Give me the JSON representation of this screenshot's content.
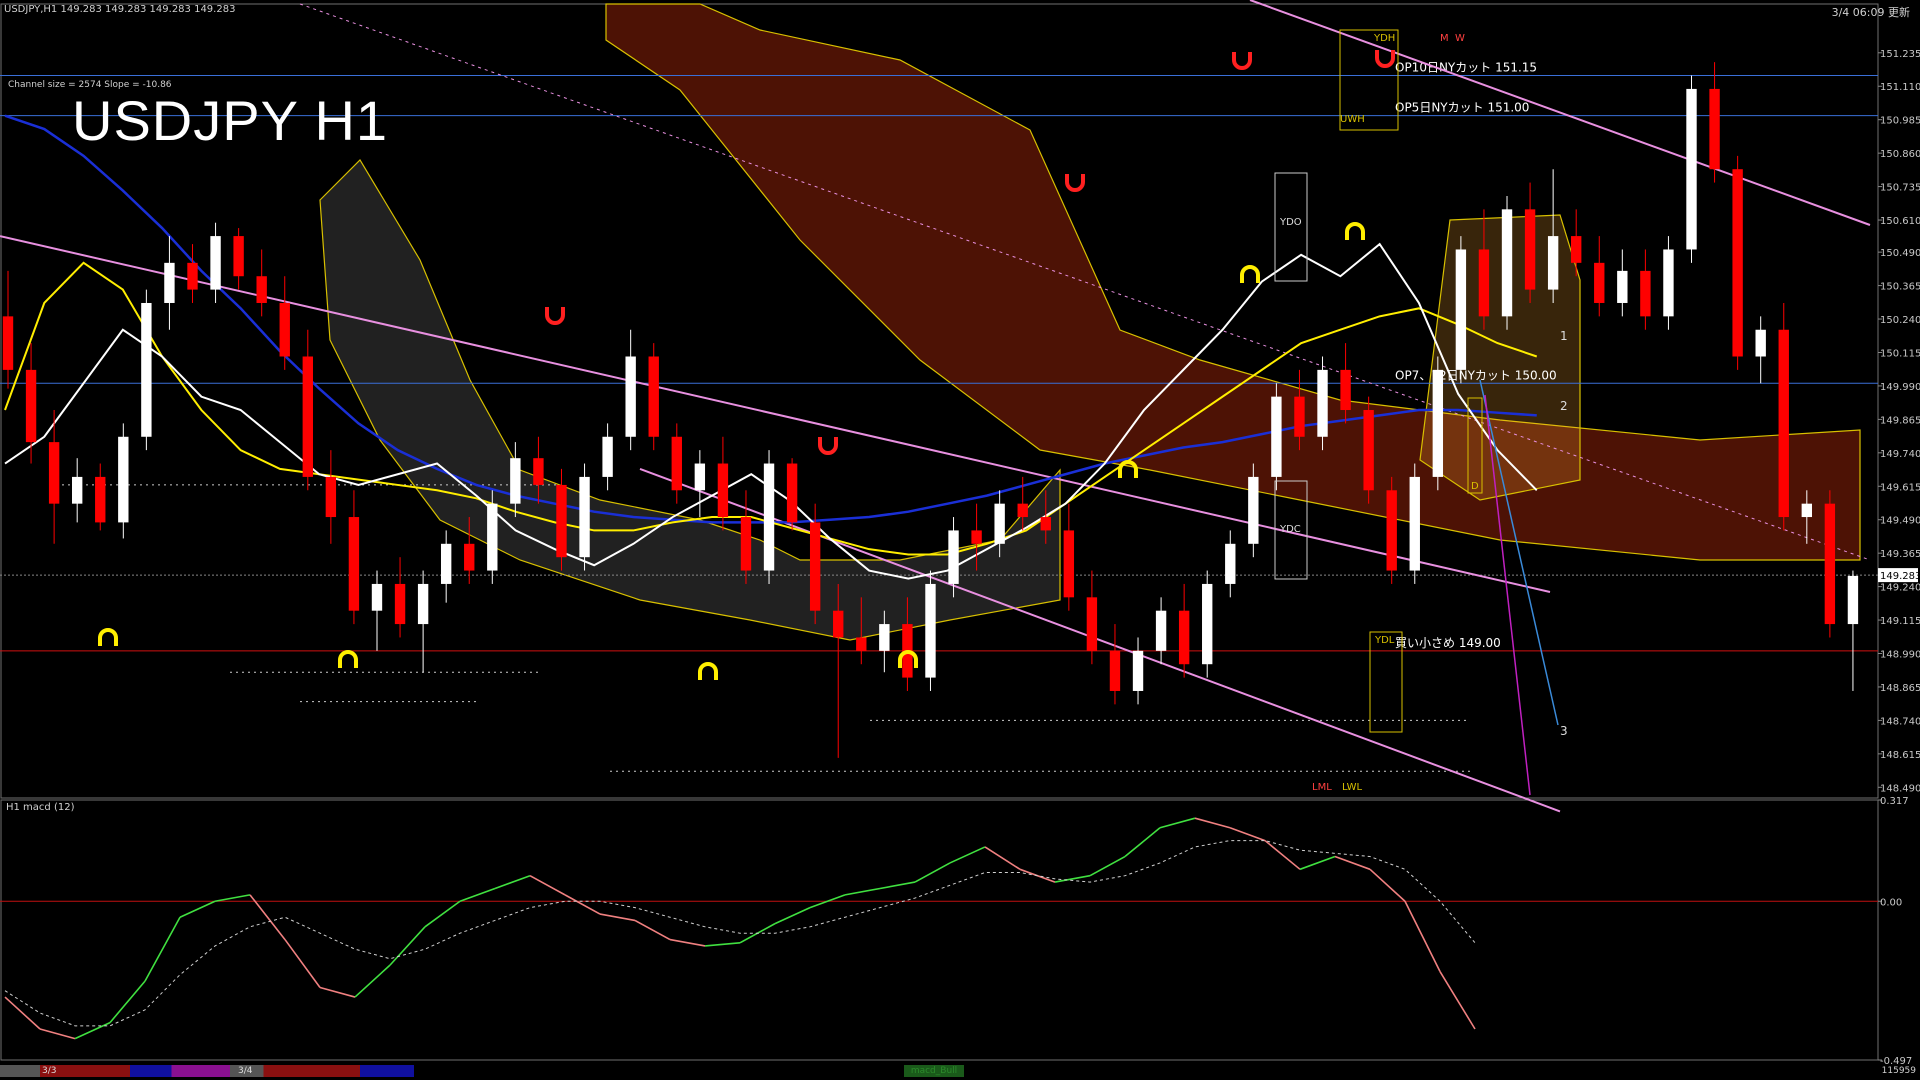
{
  "header": {
    "symbol_info": "USDJPY,H1",
    "ohlc": "149.283 149.283 149.283 149.283",
    "channel_info": "Channel size = 2574 Slope = -10.86",
    "timestamp": "3/4 06:09 更新"
  },
  "watermark": "USDJPY H1",
  "indicator_panel": {
    "label": "H1 macd (12)"
  },
  "colors": {
    "background": "#000000",
    "bull_candle": "#ffffff",
    "bear_candle": "#ff0000",
    "ma_white": "#ffffff",
    "ma_yellow": "#ffee00",
    "ma_blue": "#1a2fd6",
    "channel_pink": "#e890e0",
    "option_line_blue": "#3a6fd8",
    "support_red": "#d01010",
    "cloud_red": "#ff3a10",
    "cloud_white": "#e8e8e8",
    "cloud_orange": "#ffaa30",
    "cloud_edge_yellow": "#d8c000",
    "bollinger_red": "#c01010",
    "rsi_green": "#22c022",
    "macd_up": "#40e040",
    "macd_down": "#f08080",
    "signal_white": "#d0d0d0",
    "marker_yellow": "#ffee00",
    "marker_red": "#ff2020"
  },
  "chart_data": [
    {
      "type": "candlestick",
      "title": "USDJPY H1",
      "y_ticks": [
        "151.235",
        "151.110",
        "150.985",
        "150.860",
        "150.735",
        "150.610",
        "150.490",
        "150.365",
        "150.240",
        "150.115",
        "149.990",
        "149.865",
        "149.740",
        "149.615",
        "149.490",
        "149.365",
        "149.240",
        "149.115",
        "148.990",
        "148.865",
        "148.740",
        "148.615",
        "148.490"
      ],
      "current_price": "149.283",
      "ylim": [
        148.45,
        151.38
      ],
      "levels": [
        {
          "price": 151.15,
          "label": "OP10日NYカット 151.15",
          "color": "#3a6fd8"
        },
        {
          "price": 151.0,
          "label": "OP5日NYカット 151.00",
          "color": "#3a6fd8"
        },
        {
          "price": 150.0,
          "label": "OP7、12日NYカット 150.00",
          "color": "#3a6fd8"
        },
        {
          "price": 149.0,
          "label": "買い小さめ 149.00",
          "color": "#d01010"
        }
      ],
      "annotations": [
        "YDH",
        "UWH",
        "M",
        "W",
        "YDO",
        "YDC",
        "YDL",
        "D",
        "LML",
        "LWL",
        "1",
        "2",
        "3"
      ],
      "x_labels": [
        "3/3",
        "3/4"
      ],
      "bars": [
        {
          "o": 150.25,
          "h": 150.42,
          "l": 149.98,
          "c": 150.05
        },
        {
          "o": 150.05,
          "h": 150.15,
          "l": 149.7,
          "c": 149.78
        },
        {
          "o": 149.78,
          "h": 149.9,
          "l": 149.4,
          "c": 149.55
        },
        {
          "o": 149.55,
          "h": 149.72,
          "l": 149.48,
          "c": 149.65
        },
        {
          "o": 149.65,
          "h": 149.7,
          "l": 149.45,
          "c": 149.48
        },
        {
          "o": 149.48,
          "h": 149.85,
          "l": 149.42,
          "c": 149.8
        },
        {
          "o": 149.8,
          "h": 150.35,
          "l": 149.75,
          "c": 150.3
        },
        {
          "o": 150.3,
          "h": 150.55,
          "l": 150.2,
          "c": 150.45
        },
        {
          "o": 150.45,
          "h": 150.52,
          "l": 150.3,
          "c": 150.35
        },
        {
          "o": 150.35,
          "h": 150.6,
          "l": 150.3,
          "c": 150.55
        },
        {
          "o": 150.55,
          "h": 150.58,
          "l": 150.35,
          "c": 150.4
        },
        {
          "o": 150.4,
          "h": 150.5,
          "l": 150.25,
          "c": 150.3
        },
        {
          "o": 150.3,
          "h": 150.4,
          "l": 150.05,
          "c": 150.1
        },
        {
          "o": 150.1,
          "h": 150.2,
          "l": 149.6,
          "c": 149.65
        },
        {
          "o": 149.65,
          "h": 149.75,
          "l": 149.4,
          "c": 149.5
        },
        {
          "o": 149.5,
          "h": 149.6,
          "l": 149.1,
          "c": 149.15
        },
        {
          "o": 149.15,
          "h": 149.3,
          "l": 149.0,
          "c": 149.25
        },
        {
          "o": 149.25,
          "h": 149.35,
          "l": 149.05,
          "c": 149.1
        },
        {
          "o": 149.1,
          "h": 149.3,
          "l": 148.92,
          "c": 149.25
        },
        {
          "o": 149.25,
          "h": 149.45,
          "l": 149.18,
          "c": 149.4
        },
        {
          "o": 149.4,
          "h": 149.5,
          "l": 149.25,
          "c": 149.3
        },
        {
          "o": 149.3,
          "h": 149.6,
          "l": 149.25,
          "c": 149.55
        },
        {
          "o": 149.55,
          "h": 149.78,
          "l": 149.5,
          "c": 149.72
        },
        {
          "o": 149.72,
          "h": 149.8,
          "l": 149.55,
          "c": 149.62
        },
        {
          "o": 149.62,
          "h": 149.68,
          "l": 149.3,
          "c": 149.35
        },
        {
          "o": 149.35,
          "h": 149.7,
          "l": 149.3,
          "c": 149.65
        },
        {
          "o": 149.65,
          "h": 149.85,
          "l": 149.6,
          "c": 149.8
        },
        {
          "o": 149.8,
          "h": 150.2,
          "l": 149.75,
          "c": 150.1
        },
        {
          "o": 150.1,
          "h": 150.15,
          "l": 149.75,
          "c": 149.8
        },
        {
          "o": 149.8,
          "h": 149.85,
          "l": 149.55,
          "c": 149.6
        },
        {
          "o": 149.6,
          "h": 149.75,
          "l": 149.5,
          "c": 149.7
        },
        {
          "o": 149.7,
          "h": 149.8,
          "l": 149.45,
          "c": 149.5
        },
        {
          "o": 149.5,
          "h": 149.6,
          "l": 149.25,
          "c": 149.3
        },
        {
          "o": 149.3,
          "h": 149.75,
          "l": 149.25,
          "c": 149.7
        },
        {
          "o": 149.7,
          "h": 149.72,
          "l": 149.45,
          "c": 149.48
        },
        {
          "o": 149.48,
          "h": 149.55,
          "l": 149.1,
          "c": 149.15
        },
        {
          "o": 149.15,
          "h": 149.25,
          "l": 148.6,
          "c": 149.05
        },
        {
          "o": 149.05,
          "h": 149.2,
          "l": 148.95,
          "c": 149.0
        },
        {
          "o": 149.0,
          "h": 149.15,
          "l": 148.92,
          "c": 149.1
        },
        {
          "o": 149.1,
          "h": 149.2,
          "l": 148.85,
          "c": 148.9
        },
        {
          "o": 148.9,
          "h": 149.3,
          "l": 148.85,
          "c": 149.25
        },
        {
          "o": 149.25,
          "h": 149.5,
          "l": 149.2,
          "c": 149.45
        },
        {
          "o": 149.45,
          "h": 149.55,
          "l": 149.3,
          "c": 149.4
        },
        {
          "o": 149.4,
          "h": 149.6,
          "l": 149.35,
          "c": 149.55
        },
        {
          "o": 149.55,
          "h": 149.65,
          "l": 149.45,
          "c": 149.5
        },
        {
          "o": 149.5,
          "h": 149.6,
          "l": 149.4,
          "c": 149.45
        },
        {
          "o": 149.45,
          "h": 149.55,
          "l": 149.15,
          "c": 149.2
        },
        {
          "o": 149.2,
          "h": 149.3,
          "l": 148.95,
          "c": 149.0
        },
        {
          "o": 149.0,
          "h": 149.1,
          "l": 148.8,
          "c": 148.85
        },
        {
          "o": 148.85,
          "h": 149.05,
          "l": 148.8,
          "c": 149.0
        },
        {
          "o": 149.0,
          "h": 149.2,
          "l": 148.95,
          "c": 149.15
        },
        {
          "o": 149.15,
          "h": 149.25,
          "l": 148.9,
          "c": 148.95
        },
        {
          "o": 148.95,
          "h": 149.3,
          "l": 148.9,
          "c": 149.25
        },
        {
          "o": 149.25,
          "h": 149.45,
          "l": 149.2,
          "c": 149.4
        },
        {
          "o": 149.4,
          "h": 149.7,
          "l": 149.35,
          "c": 149.65
        },
        {
          "o": 149.65,
          "h": 150.0,
          "l": 149.6,
          "c": 149.95
        },
        {
          "o": 149.95,
          "h": 150.05,
          "l": 149.75,
          "c": 149.8
        },
        {
          "o": 149.8,
          "h": 150.1,
          "l": 149.75,
          "c": 150.05
        },
        {
          "o": 150.05,
          "h": 150.15,
          "l": 149.85,
          "c": 149.9
        },
        {
          "o": 149.9,
          "h": 149.95,
          "l": 149.55,
          "c": 149.6
        },
        {
          "o": 149.6,
          "h": 149.65,
          "l": 149.25,
          "c": 149.3
        },
        {
          "o": 149.3,
          "h": 149.7,
          "l": 149.25,
          "c": 149.65
        },
        {
          "o": 149.65,
          "h": 150.1,
          "l": 149.6,
          "c": 150.05
        },
        {
          "o": 150.05,
          "h": 150.55,
          "l": 150.0,
          "c": 150.5
        },
        {
          "o": 150.5,
          "h": 150.65,
          "l": 150.2,
          "c": 150.25
        },
        {
          "o": 150.25,
          "h": 150.7,
          "l": 150.2,
          "c": 150.65
        },
        {
          "o": 150.65,
          "h": 150.75,
          "l": 150.3,
          "c": 150.35
        },
        {
          "o": 150.35,
          "h": 150.8,
          "l": 150.3,
          "c": 150.55
        },
        {
          "o": 150.55,
          "h": 150.65,
          "l": 150.4,
          "c": 150.45
        },
        {
          "o": 150.45,
          "h": 150.55,
          "l": 150.25,
          "c": 150.3
        },
        {
          "o": 150.3,
          "h": 150.5,
          "l": 150.25,
          "c": 150.42
        },
        {
          "o": 150.42,
          "h": 150.5,
          "l": 150.2,
          "c": 150.25
        },
        {
          "o": 150.25,
          "h": 150.55,
          "l": 150.2,
          "c": 150.5
        },
        {
          "o": 150.5,
          "h": 151.15,
          "l": 150.45,
          "c": 151.1
        },
        {
          "o": 151.1,
          "h": 151.2,
          "l": 150.75,
          "c": 150.8
        },
        {
          "o": 150.8,
          "h": 150.85,
          "l": 150.05,
          "c": 150.1
        },
        {
          "o": 150.1,
          "h": 150.25,
          "l": 150.0,
          "c": 150.2
        },
        {
          "o": 150.2,
          "h": 150.3,
          "l": 149.45,
          "c": 149.5
        },
        {
          "o": 149.5,
          "h": 149.6,
          "l": 149.4,
          "c": 149.55
        },
        {
          "o": 149.55,
          "h": 149.6,
          "l": 149.05,
          "c": 149.1
        },
        {
          "o": 149.1,
          "h": 149.3,
          "l": 148.85,
          "c": 149.28
        }
      ],
      "ma_white": [
        149.7,
        149.8,
        150.0,
        150.2,
        150.1,
        149.95,
        149.9,
        149.78,
        149.66,
        149.62,
        149.66,
        149.7,
        149.58,
        149.45,
        149.38,
        149.32,
        149.4,
        149.5,
        149.58,
        149.66,
        149.56,
        149.42,
        149.3,
        149.27,
        149.3,
        149.38,
        149.46,
        149.55,
        149.7,
        149.9,
        150.05,
        150.2,
        150.38,
        150.48,
        150.4,
        150.52,
        150.3,
        149.96,
        149.75,
        149.6
      ],
      "ma_yellow": [
        149.9,
        150.3,
        150.45,
        150.35,
        150.1,
        149.9,
        149.75,
        149.68,
        149.66,
        149.64,
        149.62,
        149.6,
        149.57,
        149.52,
        149.48,
        149.45,
        149.45,
        149.48,
        149.5,
        149.5,
        149.46,
        149.42,
        149.38,
        149.36,
        149.36,
        149.4,
        149.45,
        149.55,
        149.65,
        149.75,
        149.85,
        149.95,
        150.05,
        150.15,
        150.2,
        150.25,
        150.28,
        150.22,
        150.15,
        150.1
      ],
      "ma_blue": [
        151.0,
        150.95,
        150.85,
        150.72,
        150.58,
        150.42,
        150.28,
        150.12,
        149.98,
        149.85,
        149.75,
        149.68,
        149.62,
        149.58,
        149.55,
        149.52,
        149.5,
        149.49,
        149.48,
        149.48,
        149.48,
        149.49,
        149.5,
        149.52,
        149.55,
        149.58,
        149.62,
        149.66,
        149.7,
        149.73,
        149.76,
        149.78,
        149.81,
        149.84,
        149.86,
        149.88,
        149.9,
        149.9,
        149.89,
        149.88
      ],
      "channel_upper": [
        150.55,
        149.22
      ],
      "channel_lower": [
        149.3,
        148.4
      ],
      "macd_ylim": [
        -0.497,
        0.317
      ],
      "macd_ticks": [
        "0.317",
        "0.00",
        "-0.497"
      ],
      "macd": [
        -0.3,
        -0.4,
        -0.43,
        -0.38,
        -0.25,
        -0.05,
        0.0,
        0.02,
        -0.12,
        -0.27,
        -0.3,
        -0.2,
        -0.08,
        0.0,
        0.04,
        0.08,
        0.02,
        -0.04,
        -0.06,
        -0.12,
        -0.14,
        -0.13,
        -0.07,
        -0.02,
        0.02,
        0.04,
        0.06,
        0.12,
        0.17,
        0.1,
        0.06,
        0.08,
        0.14,
        0.23,
        0.26,
        0.23,
        0.19,
        0.1,
        0.14,
        0.1,
        0.0,
        -0.22,
        -0.4
      ],
      "macd_signal": [
        -0.28,
        -0.35,
        -0.39,
        -0.39,
        -0.34,
        -0.23,
        -0.14,
        -0.08,
        -0.05,
        -0.1,
        -0.15,
        -0.18,
        -0.15,
        -0.1,
        -0.06,
        -0.02,
        0.0,
        0.0,
        -0.02,
        -0.05,
        -0.08,
        -0.1,
        -0.1,
        -0.08,
        -0.05,
        -0.02,
        0.01,
        0.05,
        0.09,
        0.09,
        0.07,
        0.06,
        0.08,
        0.12,
        0.17,
        0.19,
        0.19,
        0.16,
        0.15,
        0.14,
        0.1,
        0.0,
        -0.13
      ]
    }
  ],
  "footer": {
    "period_labels": [
      "3/3",
      "3/4"
    ],
    "status_tab": "macd_Bull",
    "volume": "115959"
  }
}
